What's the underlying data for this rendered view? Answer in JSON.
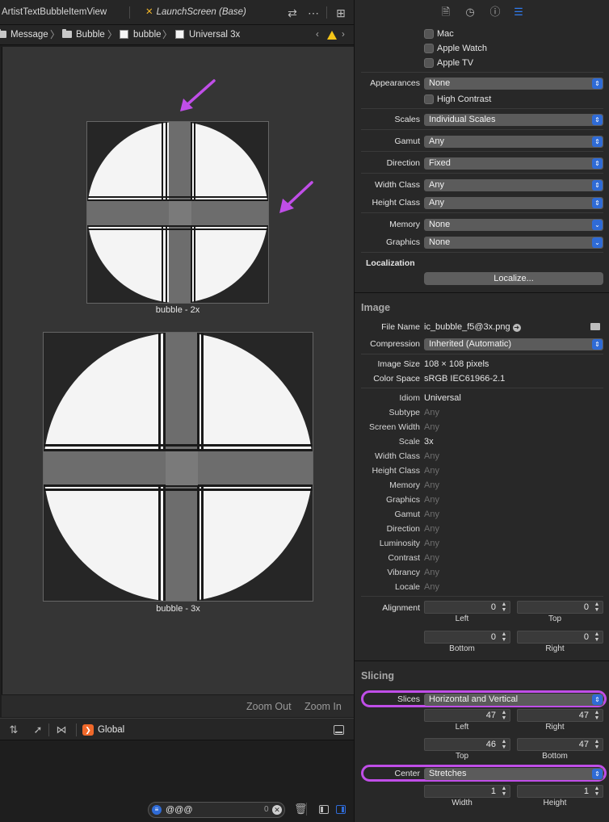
{
  "editor": {
    "tabs": [
      {
        "label": "ArtistTextBubbleItemView"
      },
      {
        "label": "LaunchScreen (Base)"
      }
    ],
    "breadcrumb": [
      "Message",
      "Bubble",
      "bubble",
      "Universal 3x"
    ],
    "images": [
      {
        "caption": "bubble - 2x"
      },
      {
        "caption": "bubble - 3x"
      }
    ],
    "zoom_out": "Zoom Out",
    "zoom_in": "Zoom In",
    "debug_scope": "Global",
    "filter_text": "@@@",
    "filter_count": "0"
  },
  "inspector": {
    "devices": {
      "mac": "Mac",
      "watch": "Apple Watch",
      "tv": "Apple TV"
    },
    "appearances": {
      "label": "Appearances",
      "value": "None"
    },
    "high_contrast": "High Contrast",
    "scales": {
      "label": "Scales",
      "value": "Individual Scales"
    },
    "gamut": {
      "label": "Gamut",
      "value": "Any"
    },
    "direction": {
      "label": "Direction",
      "value": "Fixed"
    },
    "width_class": {
      "label": "Width Class",
      "value": "Any"
    },
    "height_class": {
      "label": "Height Class",
      "value": "Any"
    },
    "memory": {
      "label": "Memory",
      "value": "None"
    },
    "graphics": {
      "label": "Graphics",
      "value": "None"
    },
    "localization": {
      "heading": "Localization",
      "button": "Localize..."
    },
    "image": {
      "heading": "Image",
      "file_name": {
        "label": "File Name",
        "value": "ic_bubble_f5@3x.png"
      },
      "compression": {
        "label": "Compression",
        "value": "Inherited (Automatic)"
      },
      "image_size": {
        "label": "Image Size",
        "value": "108 × 108 pixels"
      },
      "color_space": {
        "label": "Color Space",
        "value": "sRGB IEC61966-2.1"
      },
      "attributes": [
        {
          "label": "Idiom",
          "value": "Universal",
          "dim": false
        },
        {
          "label": "Subtype",
          "value": "Any",
          "dim": true
        },
        {
          "label": "Screen Width",
          "value": "Any",
          "dim": true
        },
        {
          "label": "Scale",
          "value": "3x",
          "dim": false
        },
        {
          "label": "Width Class",
          "value": "Any",
          "dim": true
        },
        {
          "label": "Height Class",
          "value": "Any",
          "dim": true
        },
        {
          "label": "Memory",
          "value": "Any",
          "dim": true
        },
        {
          "label": "Graphics",
          "value": "Any",
          "dim": true
        },
        {
          "label": "Gamut",
          "value": "Any",
          "dim": true
        },
        {
          "label": "Direction",
          "value": "Any",
          "dim": true
        },
        {
          "label": "Luminosity",
          "value": "Any",
          "dim": true
        },
        {
          "label": "Contrast",
          "value": "Any",
          "dim": true
        },
        {
          "label": "Vibrancy",
          "value": "Any",
          "dim": true
        },
        {
          "label": "Locale",
          "value": "Any",
          "dim": true
        }
      ],
      "alignment": {
        "label": "Alignment",
        "left": {
          "value": "0",
          "sub": "Left"
        },
        "top": {
          "value": "0",
          "sub": "Top"
        },
        "bottom": {
          "value": "0",
          "sub": "Bottom"
        },
        "right": {
          "value": "0",
          "sub": "Right"
        }
      }
    },
    "slicing": {
      "heading": "Slicing",
      "slices": {
        "label": "Slices",
        "value": "Horizontal and Vertical"
      },
      "left": {
        "value": "47",
        "sub": "Left"
      },
      "right": {
        "value": "47",
        "sub": "Right"
      },
      "top": {
        "value": "46",
        "sub": "Top"
      },
      "bottom": {
        "value": "47",
        "sub": "Bottom"
      },
      "center": {
        "label": "Center",
        "value": "Stretches"
      },
      "width": {
        "value": "1",
        "sub": "Width"
      },
      "height": {
        "value": "1",
        "sub": "Height"
      }
    }
  },
  "colors": {
    "annotation": "#c04ee8",
    "accent": "#2f6bd6",
    "warning": "#f5c518",
    "swift_orange": "#f0682a"
  }
}
